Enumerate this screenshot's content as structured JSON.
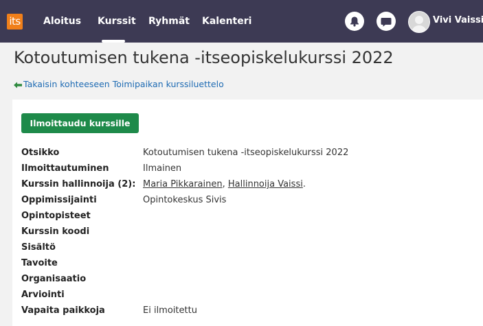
{
  "topbar": {
    "logo_text": "its",
    "logo_color": "#f07f1a",
    "nav": [
      "Aloitus",
      "Kurssit",
      "Ryhmät",
      "Kalenteri"
    ],
    "active_nav": "Kurssit",
    "bar_color": "#3d3a54",
    "user_name": "Vivi Vaissi",
    "icons": [
      "bell-icon",
      "chat-icon",
      "user-avatar-icon"
    ]
  },
  "page": {
    "title": "Kotoutumisen tukena -itseopiskelukurssi 2022",
    "back_link": "Takaisin kohteeseen Toimipaikan kurssiluettelo",
    "enroll_button": "Ilmoittaudu kurssille",
    "enroll_color": "#1e8a4a"
  },
  "details": [
    {
      "label": "Otsikko",
      "value": "Kotoutumisen tukena -itseopiskelukurssi 2022"
    },
    {
      "label": "Ilmoittautuminen",
      "value": "Ilmainen"
    },
    {
      "label": "Kurssin hallinnoija (2):",
      "links": [
        "Maria Pikkarainen",
        "Hallinnoija Vaissi"
      ],
      "separator": ", ",
      "suffix": "."
    },
    {
      "label": "Oppimissijainti",
      "value": "Opintokeskus Sivis"
    },
    {
      "label": "Opintopisteet",
      "value": ""
    },
    {
      "label": "Kurssin koodi",
      "value": ""
    },
    {
      "label": "Sisältö",
      "value": ""
    },
    {
      "label": "Tavoite",
      "value": ""
    },
    {
      "label": "Organisaatio",
      "value": ""
    },
    {
      "label": "Arviointi",
      "value": ""
    },
    {
      "label": "Vapaita paikkoja",
      "value": "Ei ilmoitettu"
    }
  ]
}
